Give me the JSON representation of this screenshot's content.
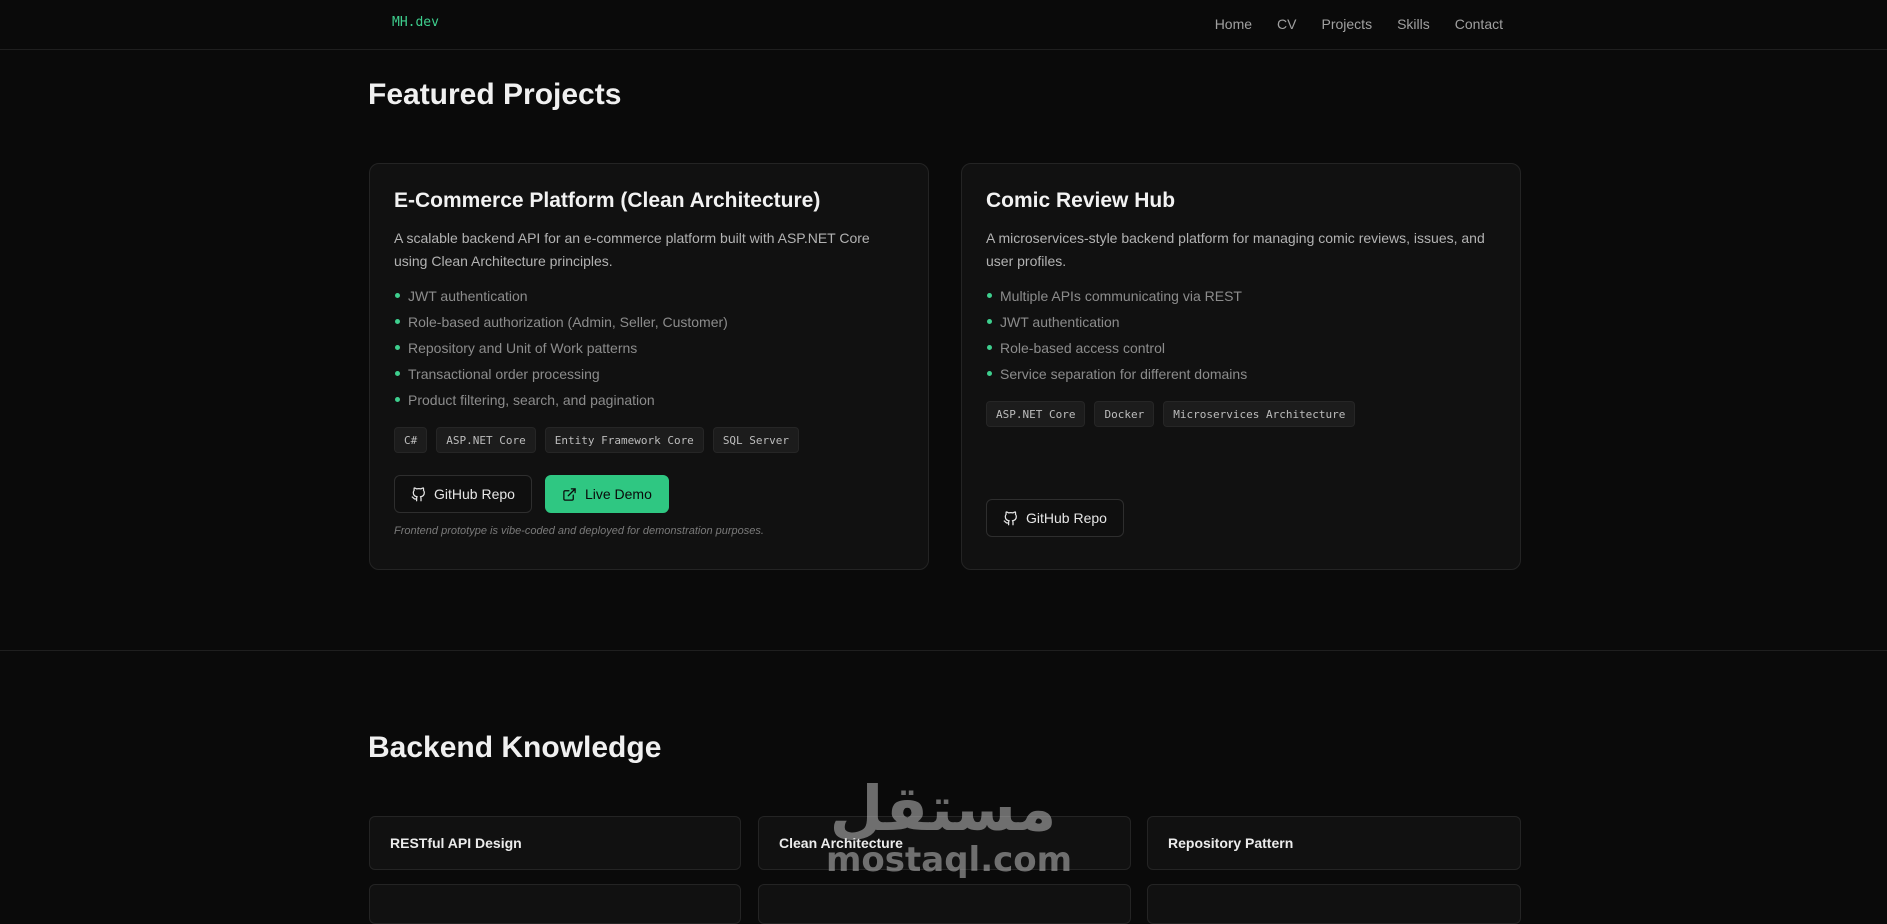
{
  "nav": {
    "logo": "MH.dev",
    "links": [
      "Home",
      "CV",
      "Projects",
      "Skills",
      "Contact"
    ]
  },
  "projects_section": {
    "title": "Featured Projects",
    "projects": [
      {
        "title": "E-Commerce Platform (Clean Architecture)",
        "description": "A scalable backend API for an e-commerce platform built with ASP.NET Core using Clean Architecture principles.",
        "features": [
          "JWT authentication",
          "Role-based authorization (Admin, Seller, Customer)",
          "Repository and Unit of Work patterns",
          "Transactional order processing",
          "Product filtering, search, and pagination"
        ],
        "tags": [
          "C#",
          "ASP.NET Core",
          "Entity Framework Core",
          "SQL Server"
        ],
        "github_label": "GitHub Repo",
        "demo_label": "Live Demo",
        "note": "Frontend prototype is vibe-coded and deployed for demonstration purposes."
      },
      {
        "title": "Comic Review Hub",
        "description": "A microservices-style backend platform for managing comic reviews, issues, and user profiles.",
        "features": [
          "Multiple APIs communicating via REST",
          "JWT authentication",
          "Role-based access control",
          "Service separation for different domains"
        ],
        "tags": [
          "ASP.NET Core",
          "Docker",
          "Microservices Architecture"
        ],
        "github_label": "GitHub Repo"
      }
    ]
  },
  "knowledge_section": {
    "title": "Backend Knowledge",
    "items": [
      "RESTful API Design",
      "Clean Architecture",
      "Repository Pattern"
    ]
  },
  "watermark": {
    "arabic": "مستقل",
    "latin": "mostaql.com"
  },
  "colors": {
    "accent": "#3ecf8e",
    "background": "#0a0a0a",
    "card": "#111111"
  }
}
